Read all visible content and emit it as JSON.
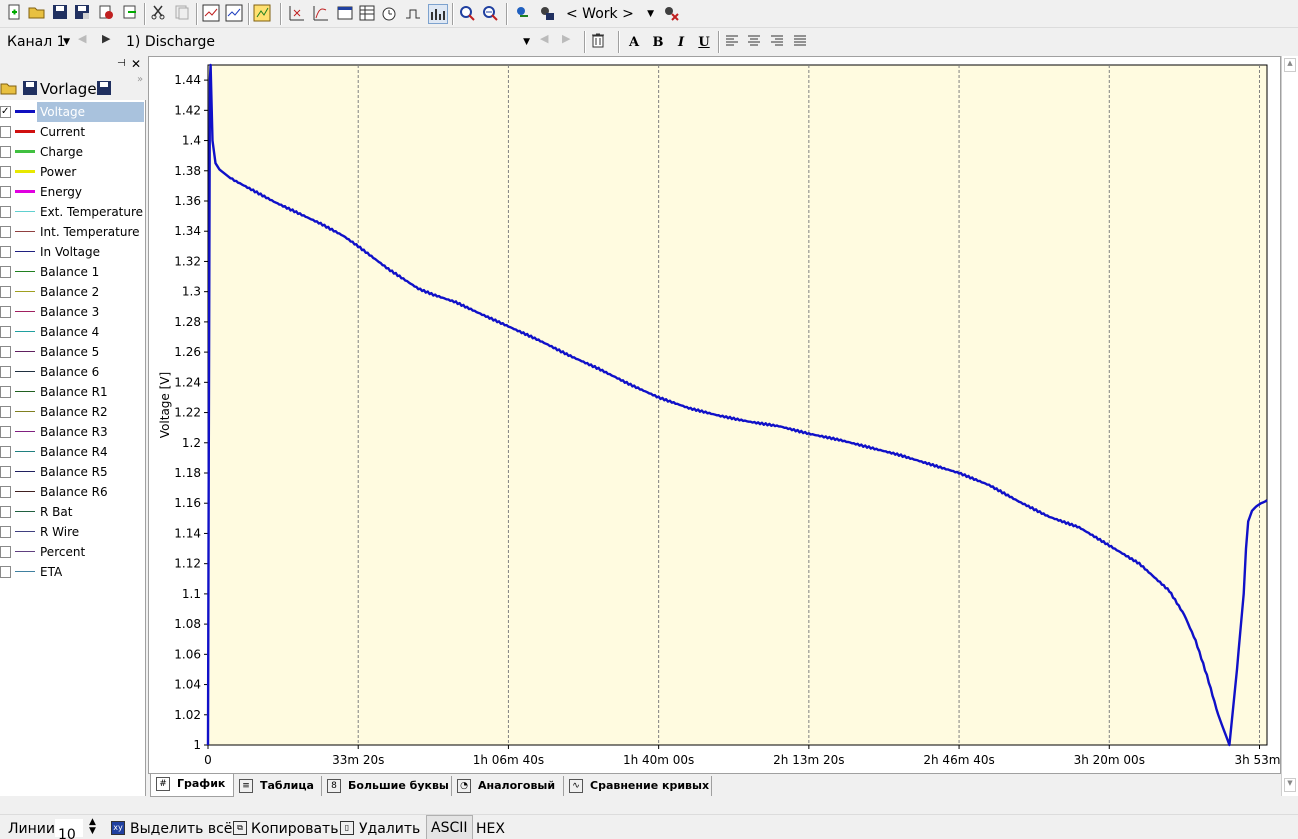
{
  "toolbar": {
    "profile": "< Work >"
  },
  "toolbar2": {
    "channel": "Канал 1",
    "curve": "1) Discharge",
    "format_buttons": [
      "A",
      "B",
      "I",
      "U"
    ]
  },
  "left_panel": {
    "title": "Vorlage",
    "params": [
      {
        "label": "Voltage",
        "color": "#1010c0",
        "checked": true,
        "selected": true
      },
      {
        "label": "Current",
        "color": "#d01010",
        "checked": false
      },
      {
        "label": "Charge",
        "color": "#40c040",
        "checked": false
      },
      {
        "label": "Power",
        "color": "#e8e800",
        "checked": false
      },
      {
        "label": "Energy",
        "color": "#e000e0",
        "checked": false
      },
      {
        "label": "Ext. Temperature",
        "color": "#60d0d0",
        "checked": false
      },
      {
        "label": "Int. Temperature",
        "color": "#904040",
        "checked": false
      },
      {
        "label": "In Voltage",
        "color": "#202080",
        "checked": false
      },
      {
        "label": "Balance 1",
        "color": "#208020",
        "checked": false
      },
      {
        "label": "Balance 2",
        "color": "#a0a020",
        "checked": false
      },
      {
        "label": "Balance 3",
        "color": "#a02060",
        "checked": false
      },
      {
        "label": "Balance 4",
        "color": "#20a0a0",
        "checked": false
      },
      {
        "label": "Balance 5",
        "color": "#602060",
        "checked": false
      },
      {
        "label": "Balance 6",
        "color": "#203040",
        "checked": false
      },
      {
        "label": "Balance R1",
        "color": "#206020",
        "checked": false
      },
      {
        "label": "Balance R2",
        "color": "#808020",
        "checked": false
      },
      {
        "label": "Balance R3",
        "color": "#802080",
        "checked": false
      },
      {
        "label": "Balance R4",
        "color": "#208080",
        "checked": false
      },
      {
        "label": "Balance R5",
        "color": "#202060",
        "checked": false
      },
      {
        "label": "Balance R6",
        "color": "#402020",
        "checked": false
      },
      {
        "label": "R Bat",
        "color": "#206040",
        "checked": false
      },
      {
        "label": "R Wire",
        "color": "#404080",
        "checked": false
      },
      {
        "label": "Percent",
        "color": "#604080",
        "checked": false
      },
      {
        "label": "ETA",
        "color": "#4080a0",
        "checked": false
      }
    ]
  },
  "chart_data": {
    "type": "line",
    "ylabel": "Voltage [V]",
    "y_ticks": [
      "1",
      "1.02",
      "1.04",
      "1.06",
      "1.08",
      "1.1",
      "1.12",
      "1.14",
      "1.16",
      "1.18",
      "1.2",
      "1.22",
      "1.24",
      "1.26",
      "1.28",
      "1.3",
      "1.32",
      "1.34",
      "1.36",
      "1.38",
      "1.4",
      "1.42",
      "1.44"
    ],
    "x_ticks": [
      "0",
      "33m 20s",
      "1h 06m 40s",
      "1h 40m 00s",
      "2h 13m 20s",
      "2h 46m 40s",
      "3h 20m 00s",
      "3h 53m"
    ],
    "ylim": [
      1.0,
      1.45
    ],
    "xlim_seconds": [
      0,
      14100
    ],
    "background": "#fffbe0",
    "line_color": "#1010c8",
    "grid": "vertical dashed",
    "series": [
      {
        "x_seconds": [
          0,
          10,
          25,
          35,
          60,
          100,
          150,
          300,
          600,
          900,
          1200,
          1500,
          1800,
          2000,
          2400,
          2800,
          3000,
          3300,
          3600,
          4000,
          4400,
          4800,
          5200,
          5600,
          6000,
          6400,
          6800,
          7200,
          7600,
          8000,
          8400,
          8800,
          9200,
          9600,
          10000,
          10400,
          10800,
          11200,
          11600,
          12000,
          12400,
          12800,
          13000,
          13150,
          13300,
          13450,
          13600,
          13700,
          13790,
          13820,
          13850,
          13900,
          13960,
          14020,
          14070,
          14100
        ],
        "values": [
          1.0,
          1.2,
          1.44,
          1.45,
          1.4,
          1.385,
          1.381,
          1.375,
          1.367,
          1.359,
          1.352,
          1.345,
          1.337,
          1.33,
          1.315,
          1.302,
          1.298,
          1.293,
          1.286,
          1.277,
          1.268,
          1.258,
          1.249,
          1.239,
          1.23,
          1.223,
          1.218,
          1.214,
          1.211,
          1.206,
          1.202,
          1.197,
          1.192,
          1.186,
          1.18,
          1.172,
          1.161,
          1.151,
          1.144,
          1.132,
          1.12,
          1.102,
          1.086,
          1.069,
          1.046,
          1.02,
          1.0,
          1.05,
          1.1,
          1.13,
          1.148,
          1.155,
          1.158,
          1.16,
          1.161,
          1.162
        ]
      }
    ]
  },
  "tabs": [
    {
      "label": "График",
      "active": true
    },
    {
      "label": "Таблица"
    },
    {
      "label": "Большие буквы"
    },
    {
      "label": "Аналоговый"
    },
    {
      "label": "Сравнение кривых"
    }
  ],
  "bottom": {
    "lines_label": "Линии",
    "lines_value": "10",
    "select_all": "Выделить всё",
    "copy": "Копировать",
    "delete": "Удалить",
    "ascii": "ASCII",
    "hex": "HEX"
  }
}
